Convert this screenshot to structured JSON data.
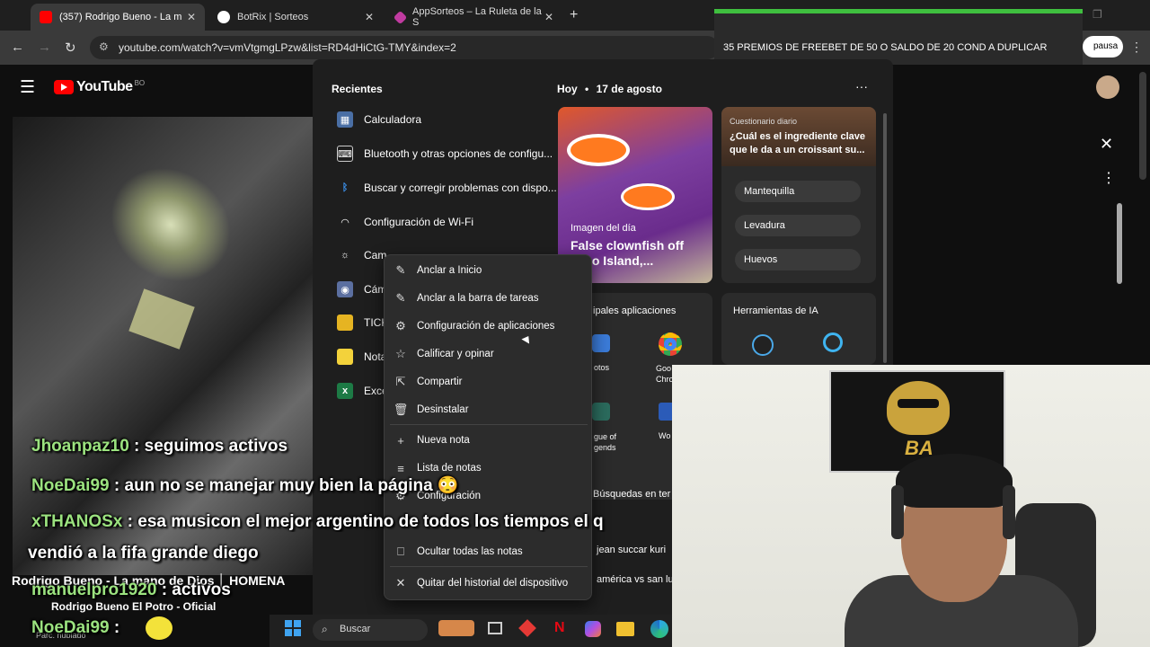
{
  "browser": {
    "tabs": [
      {
        "title": "(357) Rodrigo Bueno - La m",
        "active": true
      },
      {
        "title": "BotRix | Sorteos",
        "active": false
      },
      {
        "title": "AppSorteos – La Ruleta de la S",
        "active": false
      }
    ],
    "url": "youtube.com/watch?v=vmVtgmgLPzw&list=RD4dHiCtG-TMY&index=2",
    "pause_label": "pausa"
  },
  "youtube": {
    "logo_text": "YouTube",
    "country": "BO",
    "video_title": "Rodrigo Bueno - La mano de Dios │ HOMENA",
    "channel": "Rodrigo Bueno El Potro - Oficial",
    "bottom_text": "Parc. nublado"
  },
  "banner": {
    "text": "35 PREMIOS DE FREEBET DE 50 O SALDO DE 20 COND A DUPLICAR"
  },
  "widgets": {
    "recent_title": "Recientes",
    "recent_items": [
      {
        "label": "Calculadora"
      },
      {
        "label": "Bluetooth y otras opciones de configu..."
      },
      {
        "label": "Buscar y corregir problemas con dispo..."
      },
      {
        "label": "Configuración de Wi-Fi"
      },
      {
        "label": "Cam"
      },
      {
        "label": "Cám"
      },
      {
        "label": "TICK"
      },
      {
        "label": "Nota"
      },
      {
        "label": "Exce"
      }
    ],
    "today_label": "Hoy",
    "date": "17 de agosto",
    "more": "···",
    "image_of_day": {
      "caption": "Imagen del día",
      "title": "False clownfish off Tilao Island,..."
    },
    "quiz": {
      "header": "Cuestionario diario",
      "question": "¿Cuál es el ingrediente clave que le da a un croissant su...",
      "options": [
        "Mantequilla",
        "Levadura",
        "Huevos"
      ]
    },
    "apps_title": "ipales aplicaciones",
    "apps": [
      {
        "label": "otos"
      },
      {
        "label": "Goo Chro"
      },
      {
        "label": "gue of gends"
      },
      {
        "label": "Wo"
      }
    ],
    "ai_title": "Herramientas de IA",
    "searches_title": "Búsquedas en ter",
    "searches": [
      "jean succar kuri",
      "américa vs san lu"
    ]
  },
  "context_menu": {
    "items": [
      {
        "label": "Anclar a Inicio",
        "icon": "pin-icon"
      },
      {
        "label": "Anclar a la barra de tareas",
        "icon": "pin-icon"
      },
      {
        "label": "Configuración de aplicaciones",
        "icon": "gear-icon"
      },
      {
        "label": "Calificar y opinar",
        "icon": "star-icon"
      },
      {
        "label": "Compartir",
        "icon": "share-icon"
      },
      {
        "label": "Desinstalar",
        "icon": "trash-icon"
      },
      {
        "label": "Nueva nota",
        "icon": "plus-icon"
      },
      {
        "label": "Lista de notas",
        "icon": "list-icon"
      },
      {
        "label": "Configuración",
        "icon": "gear-icon"
      },
      {
        "label": "Ocultar todas las notas",
        "icon": "hide-icon"
      },
      {
        "label": "Quitar del historial del dispositivo",
        "icon": "close-icon"
      }
    ]
  },
  "chat": [
    {
      "user": "Jhoanpaz10",
      "message": ": seguimos activos"
    },
    {
      "user": "NoeDai99",
      "message": ": aun no se manejar muy bien la página 😳"
    },
    {
      "user": "xTHANOSx",
      "message": ": esa musicon el mejor argentino de todos los tiempos el q"
    },
    {
      "user": "",
      "message": "vendió a la fifa grande diego"
    },
    {
      "user": "manuelpro1920",
      "message": ": activos"
    },
    {
      "user": "NoeDai99",
      "message": ":"
    }
  ],
  "taskbar": {
    "search_placeholder": "Buscar"
  },
  "colors": {
    "accent_green": "#3fbf3f",
    "chat_user": "#9be27f",
    "youtube_red": "#ff0000"
  }
}
